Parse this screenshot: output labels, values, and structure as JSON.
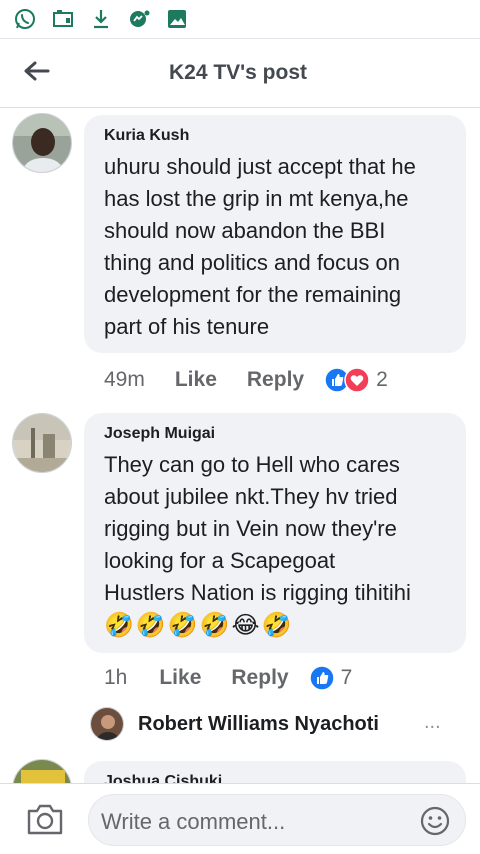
{
  "status_bar": {
    "icons": [
      "whatsapp-icon",
      "screen-cast-icon",
      "download-icon",
      "messenger-icon",
      "gallery-icon"
    ]
  },
  "header": {
    "title": "K24 TV's post",
    "back_icon": "arrow-left-icon"
  },
  "comments": [
    {
      "author": "Kuria Kush",
      "text": "uhuru should just accept that he\nhas lost the grip in mt kenya,he\nshould now  abandon the BBI\nthing and politics and focus on\ndevelopment for the remaining\npart of his tenure",
      "time": "49m",
      "like_label": "Like",
      "reply_label": "Reply",
      "reactions": [
        "like",
        "love"
      ],
      "reaction_count": "2"
    },
    {
      "author": "Joseph Muigai",
      "text": "They can go to Hell who cares\nabout jubilee nkt.They hv tried\nrigging but in Vein now they're\nlooking for a Scapegoat\nHustlers Nation is rigging tihitihi",
      "emojis": "🤣🤣🤣🤣😂🤣",
      "time": "1h",
      "like_label": "Like",
      "reply_label": "Reply",
      "reactions": [
        "like"
      ],
      "reaction_count": "7",
      "reply_preview": {
        "author": "Robert Williams Nyachoti",
        "more": "..."
      }
    },
    {
      "author": "Joshua Cishuki"
    }
  ],
  "composer": {
    "placeholder": "Write a comment...",
    "camera_icon": "camera-icon",
    "emoji_icon": "smiley-icon"
  },
  "colors": {
    "bubble": "#f0f2f5",
    "like_blue": "#1877f2",
    "love_red": "#f33e58",
    "secondary_text": "#65676b"
  }
}
